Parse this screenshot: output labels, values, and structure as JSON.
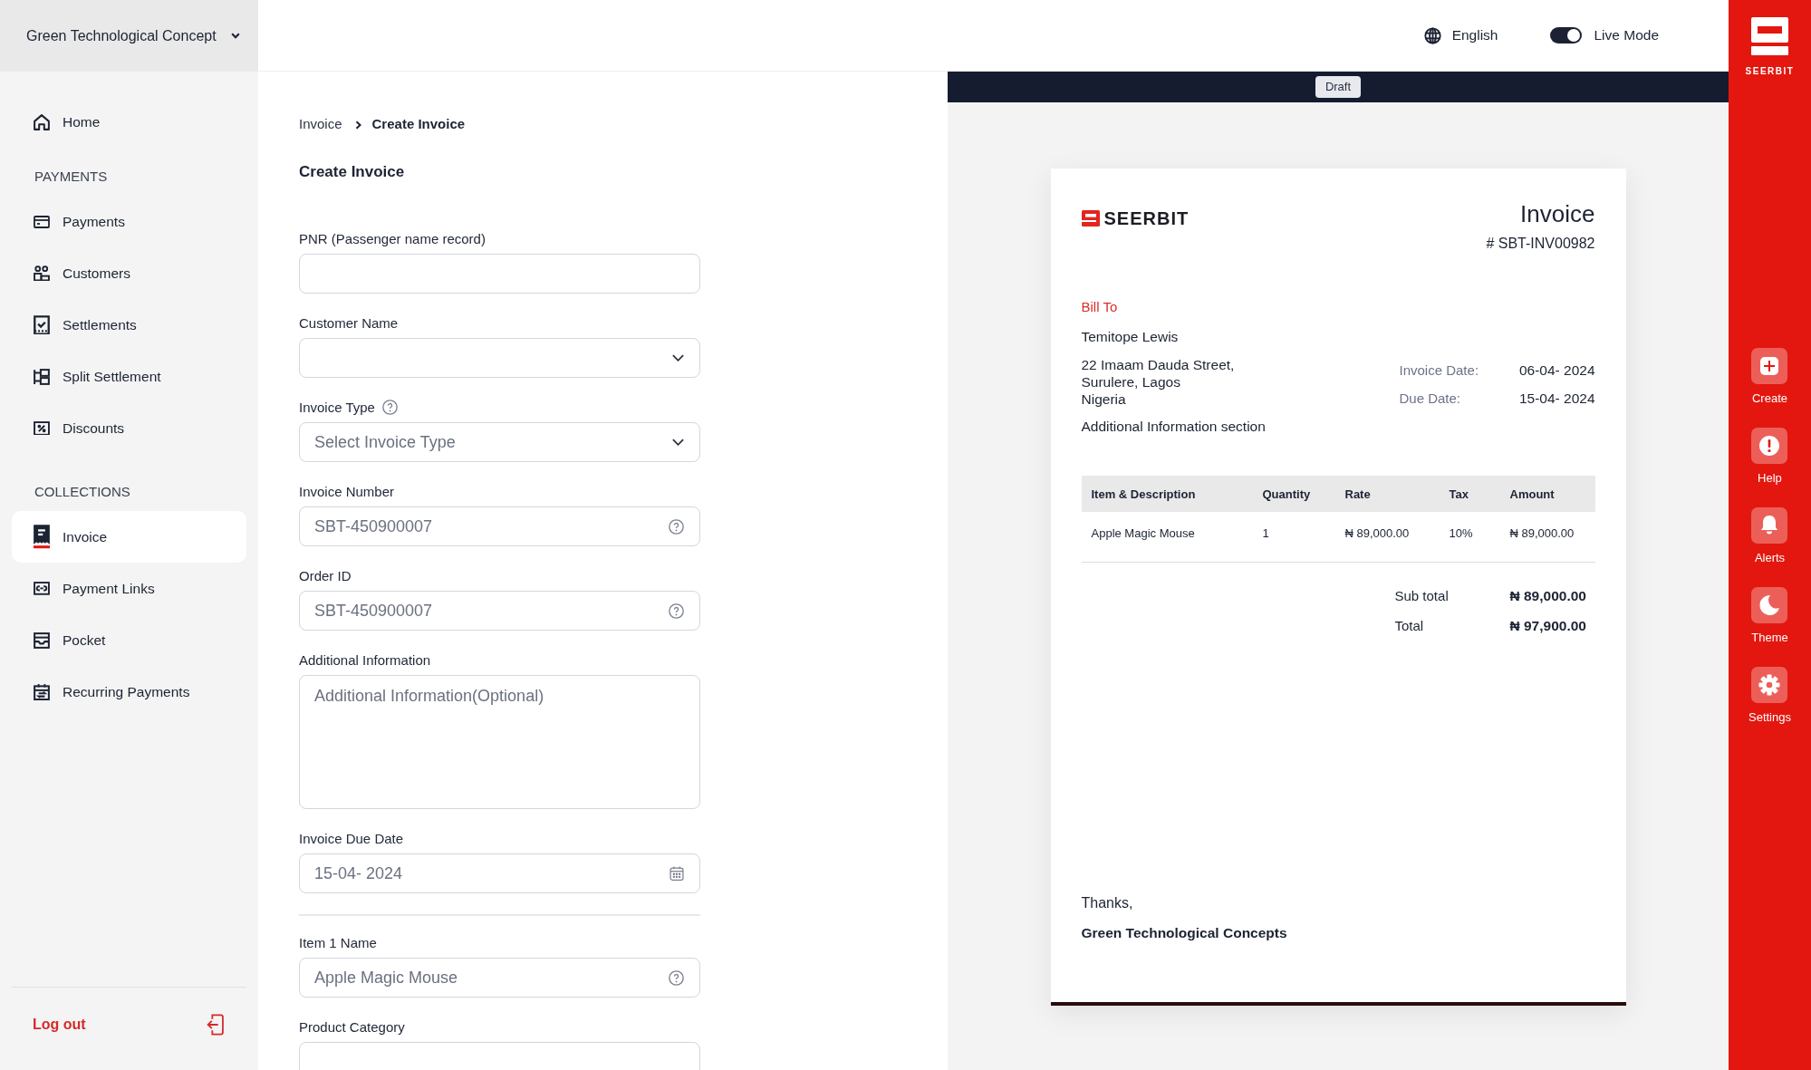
{
  "sidebar": {
    "organization": "Green Technological Concept",
    "home": {
      "label": "Home",
      "selected": false
    },
    "sections": [
      {
        "heading": "PAYMENTS",
        "items": [
          {
            "label": "Payments",
            "selected": false
          },
          {
            "label": "Customers",
            "selected": false
          },
          {
            "label": "Settlements",
            "selected": false
          },
          {
            "label": "Split Settlement",
            "selected": false
          },
          {
            "label": "Discounts",
            "selected": false
          }
        ]
      },
      {
        "heading": "COLLECTIONS",
        "items": [
          {
            "label": "Invoice",
            "selected": true
          },
          {
            "label": "Payment Links",
            "selected": false
          },
          {
            "label": "Pocket",
            "selected": false
          },
          {
            "label": "Recurring Payments",
            "selected": false
          }
        ]
      }
    ],
    "logout": "Log out"
  },
  "topbar": {
    "language": "English",
    "live_mode": {
      "label": "Live Mode",
      "on": true
    }
  },
  "breadcrumb": [
    {
      "label": "Invoice",
      "current": false
    },
    {
      "label": "Create Invoice",
      "current": true
    }
  ],
  "form": {
    "title": "Create Invoice",
    "fields": [
      {
        "kind": "text",
        "label": "PNR (Passenger name record)",
        "label_help": false,
        "help": false
      },
      {
        "kind": "select",
        "label": "Customer Name",
        "label_help": false,
        "help": false
      },
      {
        "kind": "select",
        "label": "Invoice Type",
        "label_help": true,
        "help": false,
        "placeholder": "Select Invoice Type"
      },
      {
        "kind": "text",
        "label": "Invoice Number",
        "label_help": false,
        "help": true,
        "value": "SBT-450900007"
      },
      {
        "kind": "text",
        "label": "Order ID",
        "label_help": false,
        "help": true,
        "value": "SBT-450900007"
      },
      {
        "kind": "textarea",
        "label": "Additional Information",
        "label_help": false,
        "help": false,
        "placeholder": "Additional Information(Optional)"
      },
      {
        "kind": "date",
        "label": "Invoice Due Date",
        "label_help": false,
        "help": false,
        "value": "15-04- 2024"
      }
    ],
    "item_fields": [
      {
        "kind": "text",
        "label": "Item 1 Name",
        "label_help": false,
        "help": true,
        "value": "Apple Magic Mouse"
      },
      {
        "kind": "text",
        "label": "Product Category",
        "label_help": false,
        "help": false
      }
    ]
  },
  "preview": {
    "status": "Draft",
    "invoice": {
      "brand": "SEERBIT",
      "title": "Invoice",
      "number": "# SBT-INV00982",
      "bill_to": "Bill To",
      "customer": "Temitope Lewis",
      "address": [
        "22 Imaam Dauda Street,",
        "Surulere, Lagos",
        "Nigeria"
      ],
      "note": "Additional Information section",
      "dates": [
        {
          "label": "Invoice Date:",
          "value": "06-04- 2024"
        },
        {
          "label": "Due Date:",
          "value": "15-04- 2024"
        }
      ],
      "table": {
        "columns": [
          "Item & Description",
          "Quantity",
          "Rate",
          "Tax",
          "Amount"
        ],
        "rows": [
          [
            "Apple Magic Mouse",
            "1",
            "₦ 89,000.00",
            "10%",
            "₦ 89,000.00"
          ]
        ]
      },
      "totals": [
        {
          "label": "Sub total",
          "value": "₦ 89,000.00"
        },
        {
          "label": "Total",
          "value": "₦ 97,900.00"
        }
      ],
      "closing": "Thanks,",
      "signature": "Green Technological Concepts"
    }
  },
  "rail": {
    "brand": "SEERBIT",
    "actions": [
      {
        "label": "Create"
      },
      {
        "label": "Help"
      },
      {
        "label": "Alerts"
      },
      {
        "label": "Theme"
      },
      {
        "label": "Settings"
      }
    ]
  }
}
